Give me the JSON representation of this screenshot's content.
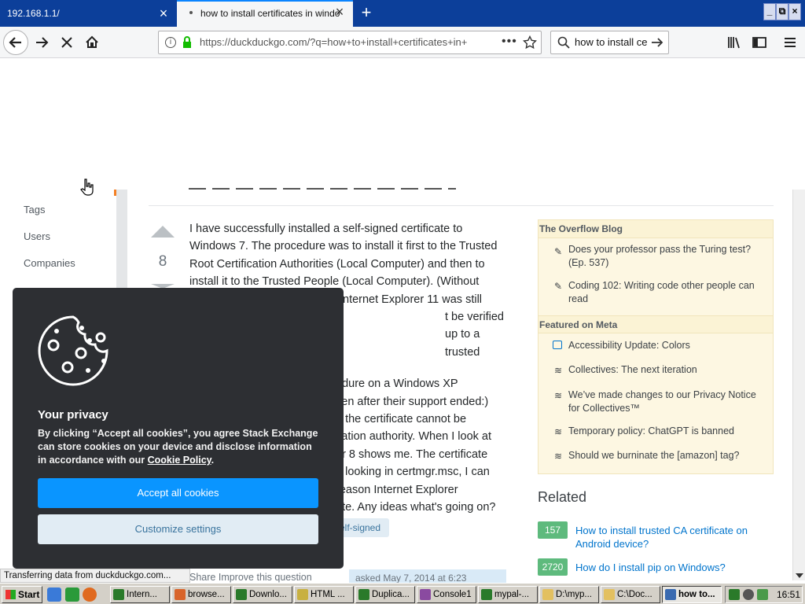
{
  "browser": {
    "tabs": [
      {
        "label": "192.168.1.1/",
        "active": false
      },
      {
        "label": "how to install certificates in windo",
        "active": true
      }
    ],
    "new_tab": "+",
    "window_buttons": [
      "_",
      "⧉",
      "×"
    ],
    "url": "https://duckduckgo.com/?q=how+to+install+certificates+in+",
    "url_domain": "duckduckgo.com",
    "search_value": "how to install ce",
    "status": "Transferring data from duckduckgo.com..."
  },
  "left_nav": {
    "items": [
      "Tags",
      "Users",
      "Companies"
    ]
  },
  "question": {
    "vote_count": "8",
    "answer_text": "I have successfully installed a self-signed certificate to Windows 7. The procedure was to install it first to the Trusted Root Certification Authorities (Local Computer) and then to install it to the Trusted People (Local Computer). (Without the second step, I think Internet Explorer 11 was still complaining it could not be verified up to a trusted root)...",
    "answer_lines": [
      "I have successfully installed a self-signed certificate to",
      "Windows 7. The procedure was to install it first to the Trusted",
      "Root Certification Authorities (Local Computer) and then to",
      "install it to the Trusted People (Local Computer). (Without",
      "nternet Explorer 11 was still",
      "t be verified up to a trusted",
      "",
      "edure on a Windows XP",
      "ven after their support ended:)",
      "g the certificate cannot be",
      "cation authority. When I look at",
      "er 8 shows me. The certificate",
      "n looking in certmgr.msc, I can",
      "reason Internet Explorer",
      "ate. Any ideas what's going on?"
    ],
    "tag": "self-signed",
    "share": "Share",
    "improve": "Improve this question",
    "asked": "asked May 7, 2014 at 6:23"
  },
  "sidebar": {
    "blog_title": "The Overflow Blog",
    "blog_items": [
      "Does your professor pass the Turing test? (Ep. 537)",
      "Coding 102: Writing code other people can read"
    ],
    "meta_title": "Featured on Meta",
    "meta_items": [
      "Accessibility Update: Colors",
      "Collectives: The next iteration",
      "We’ve made changes to our Privacy Notice for Collectives™",
      "Temporary policy: ChatGPT is banned",
      "Should we burninate the [amazon] tag?"
    ],
    "related_title": "Related",
    "related": [
      {
        "count": "157",
        "title": "How to install trusted CA certificate on Android device?"
      },
      {
        "count": "2720",
        "title": "How do I install pip on Windows?"
      }
    ]
  },
  "cookie": {
    "title": "Your privacy",
    "text_before": "By clicking “Accept all cookies”, you agree Stack Exchange can store cookies on your device and disclose information in accordance with our ",
    "link": "Cookie Policy",
    "text_after": ".",
    "accept": "Accept all cookies",
    "customize": "Customize settings"
  },
  "taskbar": {
    "start": "Start",
    "tasks": [
      {
        "label": "Intern...",
        "color": "#2a7a2a"
      },
      {
        "label": "browse...",
        "color": "#d8642a"
      },
      {
        "label": "Downlo...",
        "color": "#2a7a2a"
      },
      {
        "label": "HTML ...",
        "color": "#c8b040"
      },
      {
        "label": "Duplica...",
        "color": "#2a7a2a"
      },
      {
        "label": "Console1",
        "color": "#8a4aa0"
      },
      {
        "label": "mypal-...",
        "color": "#2a7a2a"
      },
      {
        "label": "D:\\myp...",
        "color": "#e3c060"
      },
      {
        "label": "C:\\Doc...",
        "color": "#e3c060"
      },
      {
        "label": "how to...",
        "color": "#3a6ab0"
      }
    ],
    "clock": "16:51"
  },
  "colors": {
    "tabbar": "#0c3f9a",
    "accept_button": "#0a95ff",
    "related_badge": "#5eba7d",
    "cookie_bg": "#2d2f33"
  }
}
